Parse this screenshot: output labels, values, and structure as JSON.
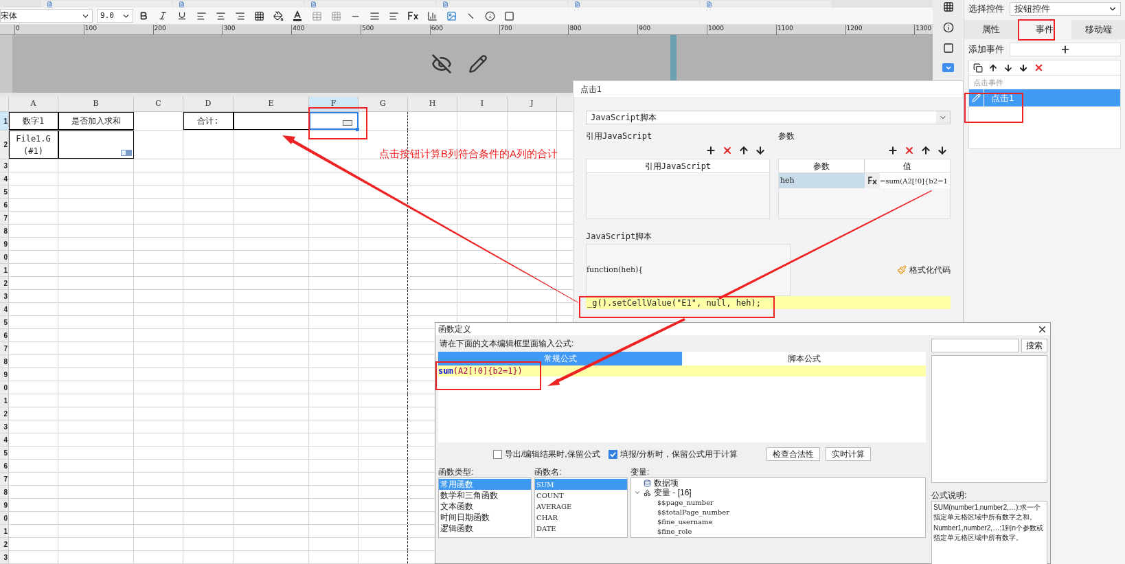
{
  "toolbar": {
    "font": "宋体",
    "size": "9.0"
  },
  "ruler": {
    "ticks": [
      "0",
      "100",
      "200",
      "300",
      "400",
      "500",
      "600",
      "700",
      "800",
      "900",
      "1000",
      "1100",
      "1200",
      "1300"
    ]
  },
  "sheet": {
    "columns": [
      {
        "label": "A",
        "selected": false
      },
      {
        "label": "B",
        "selected": false
      },
      {
        "label": "C",
        "selected": false
      },
      {
        "label": "D",
        "selected": false
      },
      {
        "label": "E",
        "selected": false
      },
      {
        "label": "F",
        "selected": true
      },
      {
        "label": "G",
        "selected": false
      },
      {
        "label": "H",
        "selected": false
      },
      {
        "label": "I",
        "selected": false
      },
      {
        "label": "J",
        "selected": false
      }
    ],
    "rows": [
      {
        "header": "1",
        "selected": true,
        "cells": [
          {
            "text": "数字1",
            "bordered": true,
            "selected": false
          },
          {
            "text": "是否加入求和",
            "bordered": true,
            "selected": false
          },
          {
            "bordered": false,
            "selected": false
          },
          {
            "text": "合计:",
            "bordered": true,
            "selected": false
          },
          {
            "bordered": true,
            "selected": false
          },
          {
            "kind": "button",
            "bordered": false,
            "selected": true
          },
          {
            "bordered": false,
            "selected": false
          },
          {
            "bordered": false,
            "selected": false
          },
          {
            "bordered": false,
            "selected": false
          },
          {
            "bordered": false,
            "selected": false
          }
        ]
      },
      {
        "header": "2",
        "selected": false,
        "cells": [
          {
            "text": "File1.G(#1)",
            "bordered": true,
            "selected": false
          },
          {
            "kind": "combo",
            "bordered": true,
            "selected": false
          },
          {
            "bordered": false,
            "selected": false
          },
          {
            "bordered": false,
            "selected": false
          },
          {
            "bordered": false,
            "selected": false
          },
          {
            "bordered": false,
            "selected": false
          },
          {
            "bordered": false,
            "selected": false
          },
          {
            "bordered": false,
            "selected": false
          },
          {
            "bordered": false,
            "selected": false
          },
          {
            "bordered": false,
            "selected": false
          }
        ]
      },
      {
        "header": "3",
        "selected": false
      },
      {
        "header": "4",
        "selected": false
      },
      {
        "header": "5",
        "selected": false
      },
      {
        "header": "6",
        "selected": false
      },
      {
        "header": "7",
        "selected": false
      },
      {
        "header": "8",
        "selected": false
      },
      {
        "header": "9",
        "selected": false
      },
      {
        "header": "0",
        "selected": false
      },
      {
        "header": "1",
        "selected": false
      },
      {
        "header": "2",
        "selected": false
      },
      {
        "header": "3",
        "selected": false
      },
      {
        "header": "4",
        "selected": false
      },
      {
        "header": "5",
        "selected": false
      },
      {
        "header": "6",
        "selected": false
      },
      {
        "header": "7",
        "selected": false
      },
      {
        "header": "8",
        "selected": false
      },
      {
        "header": "9",
        "selected": false
      },
      {
        "header": "0",
        "selected": false
      },
      {
        "header": "1",
        "selected": false
      },
      {
        "header": "2",
        "selected": false
      },
      {
        "header": "3",
        "selected": false
      },
      {
        "header": "4",
        "selected": false
      },
      {
        "header": "5",
        "selected": false
      },
      {
        "header": "6",
        "selected": false
      },
      {
        "header": "7",
        "selected": false
      },
      {
        "header": "8",
        "selected": false
      },
      {
        "header": "9",
        "selected": false
      },
      {
        "header": "0",
        "selected": false
      },
      {
        "header": "1",
        "selected": false
      },
      {
        "header": "2",
        "selected": false
      },
      {
        "header": "3",
        "selected": false
      }
    ]
  },
  "annotation": "点击按钮计算B列符合条件的A列的合计",
  "right_panel": {
    "select_label": "选择控件",
    "select_value": "按钮控件",
    "tabs": [
      {
        "label": "属性",
        "selected": false
      },
      {
        "label": "事件",
        "selected": true
      },
      {
        "label": "移动端",
        "selected": false
      }
    ],
    "add_label": "添加事件",
    "list_header": "点击事件",
    "events": [
      {
        "label": "点击1",
        "selected": true
      }
    ]
  },
  "event_dialog": {
    "title": "点击1",
    "script_type": "JavaScript脚本",
    "ref_section": "引用JavaScript",
    "ref_column": "引用JavaScript",
    "params_section": "参数",
    "params_columns": [
      "参数",
      "值"
    ],
    "params": [
      {
        "name": "heh",
        "value": "=sum(A2[!0]{b2=1"
      }
    ],
    "script_section": "JavaScript脚本",
    "script_lines": [
      "function(heh){",
      "_g().setCellValue(\"E1\", null, heh);"
    ],
    "format_button": "格式化代码"
  },
  "formula_dialog": {
    "title": "函数定义",
    "prompt": "请在下面的文本编辑框里面输入公式:",
    "tabs": [
      {
        "label": "常规公式",
        "selected": true
      },
      {
        "label": "脚本公式",
        "selected": false
      }
    ],
    "formula": "**sum**(A2[!0]{b2=1})",
    "options": [
      {
        "label": "导出/编辑结果时,保留公式",
        "checked": false
      },
      {
        "label": "填报/分析时，保留公式用于计算",
        "checked": true
      }
    ],
    "buttons": [
      "检查合法性",
      "实时计算"
    ],
    "search_button": "搜索",
    "categories_label": "函数类型:",
    "categories": [
      {
        "label": "常用函数",
        "selected": true
      },
      {
        "label": "数学和三角函数",
        "selected": false
      },
      {
        "label": "文本函数",
        "selected": false
      },
      {
        "label": "时间日期函数",
        "selected": false
      },
      {
        "label": "逻辑函数",
        "selected": false
      }
    ],
    "functions_label": "函数名:",
    "functions": [
      {
        "label": "SUM",
        "selected": true
      },
      {
        "label": "COUNT",
        "selected": false
      },
      {
        "label": "AVERAGE",
        "selected": false
      },
      {
        "label": "CHAR",
        "selected": false
      },
      {
        "label": "DATE",
        "selected": false
      }
    ],
    "variables_label": "变量:",
    "variables": [
      {
        "label": "数据项",
        "kind": "data"
      },
      {
        "label": "变量 - [16]",
        "kind": "group",
        "expanded": true,
        "children": [
          {
            "label": "$$page_number"
          },
          {
            "label": "$$totalPage_number"
          },
          {
            "label": "$fine_username"
          },
          {
            "label": "$fine_role"
          }
        ]
      }
    ],
    "description_label": "公式说明:",
    "description": [
      "SUM(number1,number2,…):求一个指定单元格区域中所有数字之和。",
      "Number1,number2,…:1到n个参数或指定单元格区域中所有数字。"
    ]
  }
}
